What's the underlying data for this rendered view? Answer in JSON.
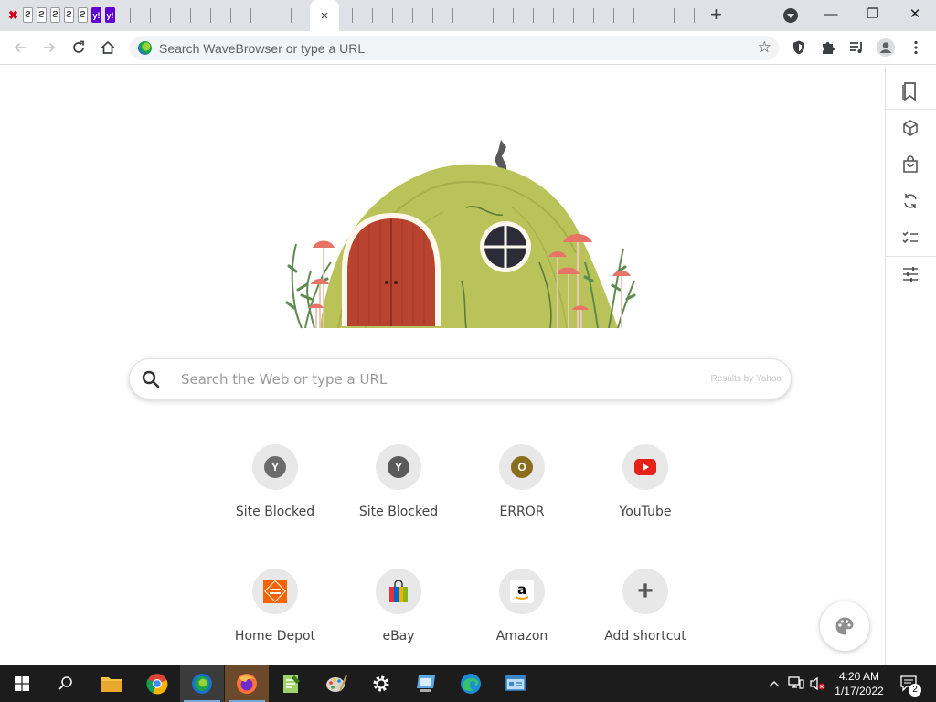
{
  "browser": {
    "active_tab_close": "×",
    "new_tab": "+",
    "window_controls": {
      "minimize": "—",
      "restore": "❐",
      "close": "✕"
    },
    "pinned_tabs": [
      {
        "glyph": "✖",
        "kind": "r"
      },
      {
        "glyph": "Ƨ",
        "kind": "e"
      },
      {
        "glyph": "Ƨ",
        "kind": "e"
      },
      {
        "glyph": "Ƨ",
        "kind": "e"
      },
      {
        "glyph": "Ƨ",
        "kind": "e"
      },
      {
        "glyph": "Ƨ",
        "kind": "e"
      },
      {
        "glyph": "y!",
        "kind": "y"
      },
      {
        "glyph": "y!",
        "kind": "y"
      }
    ]
  },
  "toolbar": {
    "omnibox_placeholder": "Search WaveBrowser or type a URL",
    "icons": [
      "back-icon",
      "forward-icon",
      "reload-icon",
      "home-icon",
      "bookmark-star-icon",
      "shield-icon",
      "extensions-icon",
      "media-playlist-icon",
      "profile-icon",
      "menu-icon"
    ]
  },
  "side_panel": {
    "icons": [
      "bookmarks-icon",
      "package-icon",
      "shopping-bag-icon",
      "sync-icon",
      "checklist-icon",
      "sliders-icon"
    ]
  },
  "search": {
    "placeholder": "Search the Web or type a URL",
    "attribution": "Results by Yahoo"
  },
  "shortcuts": [
    {
      "label": "Site Blocked",
      "glyph": "Y",
      "color": "#6b6b6b"
    },
    {
      "label": "Site Blocked",
      "glyph": "Y",
      "color": "#5a5a5a"
    },
    {
      "label": "ERROR",
      "glyph": "O",
      "color": "#8a6d1d"
    },
    {
      "label": "YouTube",
      "glyph": "youtube-logo",
      "color": "#e62117"
    },
    {
      "label": "Home Depot",
      "glyph": "home-depot-logo",
      "color": "#f96302"
    },
    {
      "label": "eBay",
      "glyph": "ebay-bag-logo",
      "color": "#3665f3"
    },
    {
      "label": "Amazon",
      "glyph": "a",
      "color": "#000000"
    },
    {
      "label": "Add shortcut",
      "glyph": "+",
      "color": "#555555"
    }
  ],
  "taskbar": {
    "clock_time": "4:20 AM",
    "clock_date": "1/17/2022",
    "notification_count": "2"
  },
  "colors": {
    "tab_strip": "#dee1e6",
    "taskbar": "#1c1c1c",
    "accent_blue": "#0078d7"
  }
}
